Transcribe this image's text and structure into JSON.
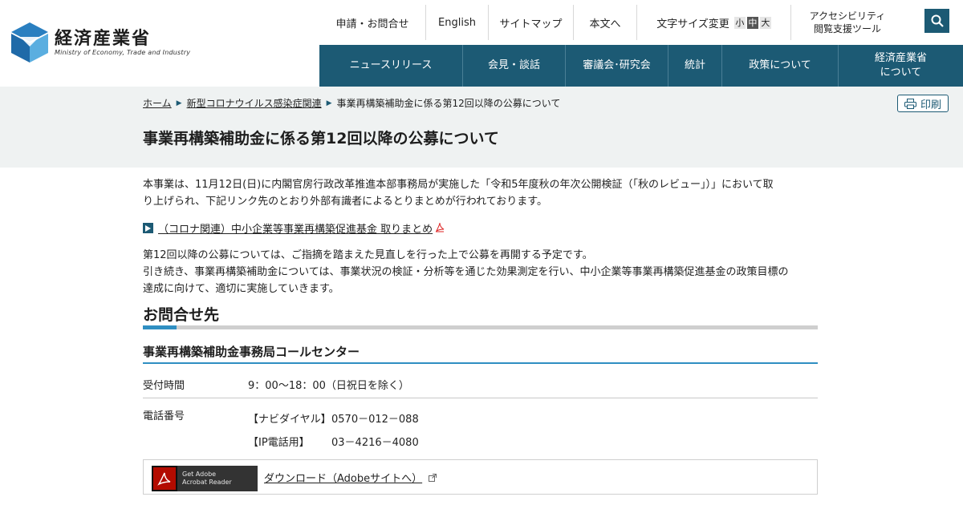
{
  "header": {
    "logo_title": "経済産業省",
    "logo_sub": "Ministry of Economy, Trade and Industry",
    "util": {
      "apply": "申請・お問合せ",
      "english": "English",
      "sitemap": "サイトマップ",
      "body": "本文へ",
      "font_size_label": "文字サイズ変更",
      "font_sizes": [
        "小",
        "中",
        "大"
      ],
      "a11y_line1": "アクセシビリティ",
      "a11y_line2": "閲覧支援ツール"
    },
    "search_icon": "search-icon",
    "gnav": [
      "ニュースリリース",
      "会見・談話",
      "審議会･研究会",
      "統計",
      "政策について",
      "経済産業省"
    ],
    "gnav_last_line2": "について",
    "brand_color": "#1c5a74"
  },
  "breadcrumb": {
    "items": [
      "ホーム",
      "新型コロナウイルス感染症関連",
      "事業再構築補助金に係る第12回以降の公募について"
    ]
  },
  "print_label": "印刷",
  "page_title": "事業再構築補助金に係る第12回以降の公募について",
  "main": {
    "intro_line1": "本事業は、11月12日(日)に内閣官房行政改革推進本部事務局が実施した「令和5年度秋の年次公開検証（「秋のレビュー」）」において取",
    "intro_line2": "り上げられ、下記リンク先のとおり外部有識者によるとりまとめが行われております。",
    "pdf_link": "（コロナ関連）中小企業等事業再構築促進基金 取りまとめ",
    "para2_line1": "第12回以降の公募については、ご指摘を踏まえた見直しを行った上で公募を再開する予定です。",
    "para2_line2": "引き続き、事業再構築補助金については、事業状況の検証・分析等を通じた効果測定を行い、中小企業等事業再構築促進基金の政策目標の",
    "para2_line3": "達成に向けて、適切に実施していきます。",
    "contact_heading": "お問合せ先",
    "center_heading": "事業再構築補助金事務局コールセンター",
    "hours_label": "受付時間",
    "hours_value": "9：00～18：00（日祝日を除く）",
    "phone_label": "電話番号",
    "phones": [
      {
        "label": "【ナビダイヤル】",
        "number": "0570－012－088"
      },
      {
        "label": "【IP電話用】",
        "number": "03－4216－4080"
      }
    ],
    "adobe_badge_line1": "Get Adobe",
    "adobe_badge_line2": "Acrobat Reader",
    "adobe_link": "ダウンロード（Adobeサイトへ）"
  }
}
